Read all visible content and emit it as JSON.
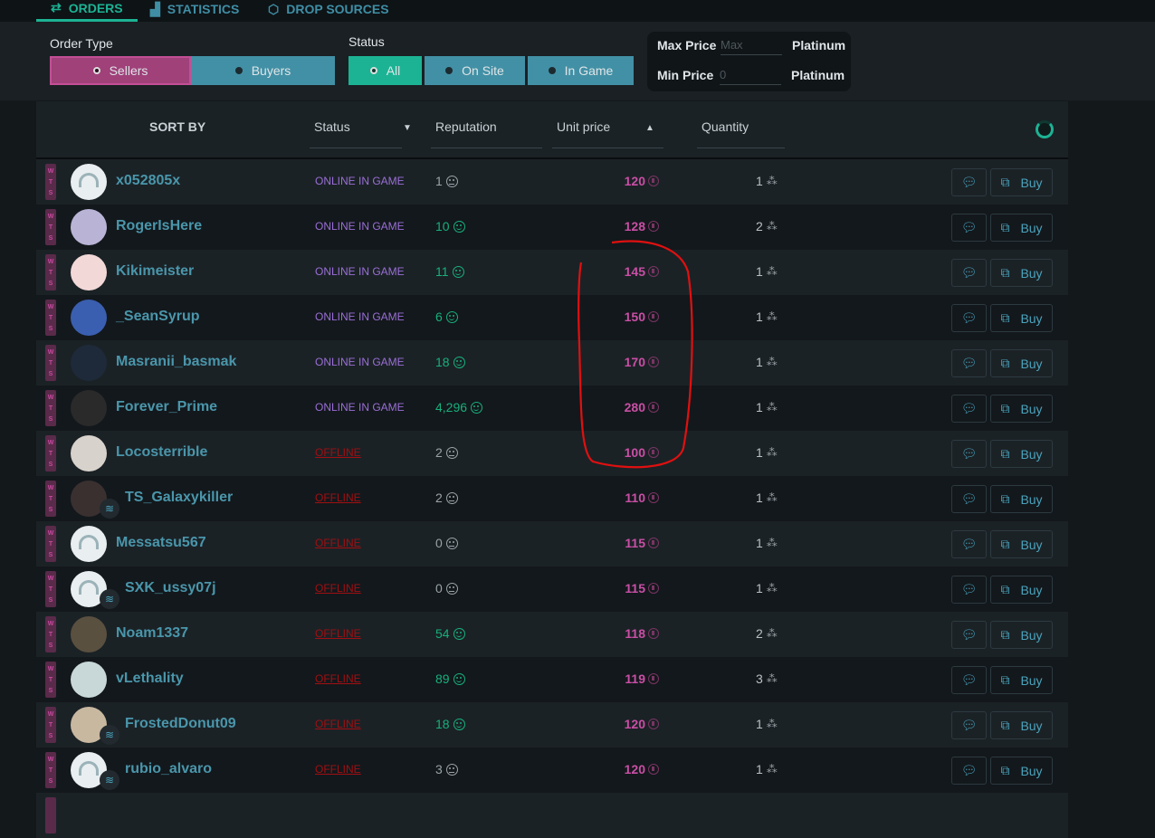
{
  "nav": {
    "tabs": [
      {
        "label": "ORDERS",
        "icon": "swap-arrows-icon",
        "active": true
      },
      {
        "label": "STATISTICS",
        "icon": "chart-icon"
      },
      {
        "label": "DROP SOURCES",
        "icon": "d20-dice-icon"
      }
    ]
  },
  "filters": {
    "order_type_label": "Order Type",
    "order_types": [
      {
        "label": "Sellers",
        "selected": true
      },
      {
        "label": "Buyers"
      }
    ],
    "status_label": "Status",
    "statuses": [
      {
        "label": "All",
        "selected": true
      },
      {
        "label": "On Site"
      },
      {
        "label": "In Game"
      }
    ],
    "max_price_label": "Max Price",
    "max_price_placeholder": "Max",
    "max_price_unit": "Platinum",
    "min_price_label": "Min Price",
    "min_price_placeholder": "0",
    "min_price_unit": "Platinum"
  },
  "table": {
    "sort_by": "SORT BY",
    "columns": {
      "status": "Status",
      "reputation": "Reputation",
      "unit_price": "Unit price",
      "quantity": "Quantity"
    },
    "buy_label": "Buy",
    "order_badge": [
      "W",
      "T",
      "S"
    ],
    "rows": [
      {
        "name": "x052805x",
        "status": "ONLINE IN GAME",
        "reputation": "1",
        "price": "120",
        "quantity": "1"
      },
      {
        "name": "RogerIsHere",
        "status": "ONLINE IN GAME",
        "reputation": "10",
        "price": "128",
        "quantity": "2"
      },
      {
        "name": "Kikimeister",
        "status": "ONLINE IN GAME",
        "reputation": "11",
        "price": "145",
        "quantity": "1"
      },
      {
        "name": "_SeanSyrup",
        "status": "ONLINE IN GAME",
        "reputation": "6",
        "price": "150",
        "quantity": "1"
      },
      {
        "name": "Masranii_basmak",
        "status": "ONLINE IN GAME",
        "reputation": "18",
        "price": "170",
        "quantity": "1"
      },
      {
        "name": "Forever_Prime",
        "status": "ONLINE IN GAME",
        "reputation": "4,296",
        "price": "280",
        "quantity": "1"
      },
      {
        "name": "Locosterrible",
        "status": "OFFLINE",
        "reputation": "2",
        "price": "100",
        "quantity": "1"
      },
      {
        "name": "TS_Galaxykiller",
        "status": "OFFLINE",
        "reputation": "2",
        "price": "110",
        "quantity": "1",
        "crossplay": true
      },
      {
        "name": "Messatsu567",
        "status": "OFFLINE",
        "reputation": "0",
        "price": "115",
        "quantity": "1"
      },
      {
        "name": "SXK_ussy07j",
        "status": "OFFLINE",
        "reputation": "0",
        "price": "115",
        "quantity": "1",
        "crossplay": true
      },
      {
        "name": "Noam1337",
        "status": "OFFLINE",
        "reputation": "54",
        "price": "118",
        "quantity": "2"
      },
      {
        "name": "vLethality",
        "status": "OFFLINE",
        "reputation": "89",
        "price": "119",
        "quantity": "3"
      },
      {
        "name": "FrostedDonut09",
        "status": "OFFLINE",
        "reputation": "18",
        "price": "120",
        "quantity": "1",
        "crossplay": true
      },
      {
        "name": "rubio_alvaro",
        "status": "OFFLINE",
        "reputation": "3",
        "price": "120",
        "quantity": "1",
        "crossplay": true
      }
    ]
  },
  "colors": {
    "accent": "#1cb394",
    "seller": "#a0417a",
    "button": "#4290a5",
    "price": "#c94fa5",
    "online": "#9a6fd6",
    "offline": "#a00f12",
    "positive": "#17b07a",
    "annotation": "#e01010"
  }
}
